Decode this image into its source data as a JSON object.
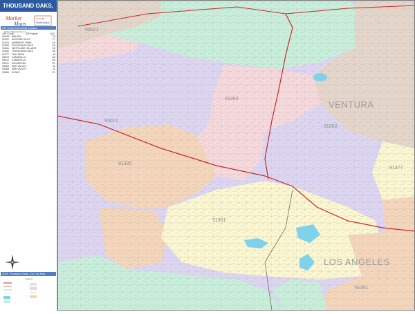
{
  "sidebar": {
    "title": "THOUSAND OAKS, CA",
    "logo": {
      "line1": "Market",
      "line2": "Maps",
      "badge_top": "ALSO BY",
      "badge_bottom": "MarketMaps"
    },
    "tagline": "Online Mapping Source",
    "locator_label": "ZIP Code Index/Grid Locator",
    "zip_table": {
      "headers": [
        "ZIP Code",
        "ZIP Name",
        "LOC"
      ],
      "rows": [
        [
          "90265",
          "MALIBU",
          "F6"
        ],
        [
          "91301",
          "AGOURA HILLS",
          "F7"
        ],
        [
          "91320",
          "NEWBURY PARK",
          "C6"
        ],
        [
          "91360",
          "THOUSAND OAKS",
          "C6"
        ],
        [
          "91361",
          "WESTLAKE VILLAGE",
          "E6"
        ],
        [
          "91362",
          "THOUSAND OAKS",
          "D6"
        ],
        [
          "91377",
          "OAK PARK",
          "J5"
        ],
        [
          "93010",
          "CAMARILLO",
          "A3"
        ],
        [
          "93012",
          "CAMARILLO",
          "D5"
        ],
        [
          "93021",
          "MOORPARK",
          "D2"
        ],
        [
          "93063",
          "SIMI VALLEY",
          "J2"
        ],
        [
          "93065",
          "SIMI VALLEY",
          "J2"
        ],
        [
          "93066",
          "SOMIS",
          "E1"
        ]
      ]
    },
    "caption": "2020 Thousand Oaks, CA City Map",
    "legend_heading": "Legend",
    "compass_icon": "compass-rose-icon"
  },
  "map": {
    "regions": {
      "ventura": "VENTURA",
      "los_angeles": "LOS ANGELES"
    },
    "zip_labels": {
      "z93021": "93021",
      "z93012": "93012",
      "z91360": "91360",
      "z91362": "91362",
      "z91320": "91320",
      "z91361": "91361",
      "z91377": "91377",
      "z91301": "91301"
    }
  },
  "colors": {
    "pink": "#f6d9dc",
    "lavender": "#ddd6f3",
    "mint": "#c8efdc",
    "peach": "#f5d6bb",
    "yellow": "#fbf7d1",
    "tan": "#e5d6cb",
    "water": "#7fd2ea",
    "highway": "#c62828",
    "title_bar": "#2c5aa0"
  }
}
